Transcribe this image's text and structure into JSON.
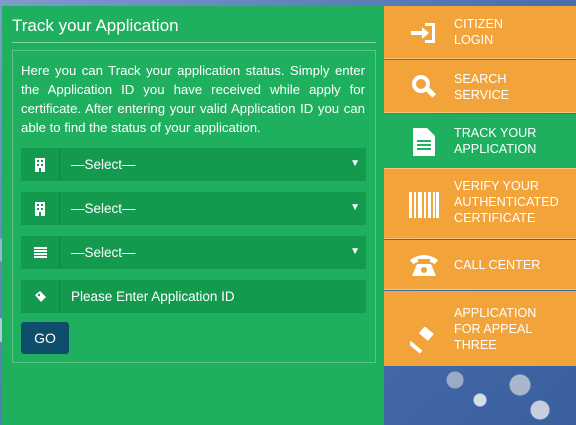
{
  "panel": {
    "title": "Track your Application",
    "description": "Here you can Track your application status. Simply enter the Application ID you have received while apply for certificate. After entering your valid Application ID you can able to find the status of your application.",
    "selects": [
      {
        "icon": "building-icon",
        "value": "—Select—"
      },
      {
        "icon": "office-icon",
        "value": "—Select—"
      },
      {
        "icon": "list-icon",
        "value": "—Select—"
      }
    ],
    "app_id_placeholder": "Please Enter Application ID",
    "go_label": "GO"
  },
  "menu": [
    {
      "icon": "login-icon",
      "label_1": "CITIZEN",
      "label_2": "LOGIN"
    },
    {
      "icon": "search-icon",
      "label_1": "SEARCH",
      "label_2": "SERVICE"
    },
    {
      "icon": "document-icon",
      "label_1": "TRACK YOUR",
      "label_2": "APPLICATION"
    },
    {
      "icon": "barcode-icon",
      "label_1": "VERIFY YOUR",
      "label_2": "AUTHENTICATED",
      "label_3": "CERTIFICATE"
    },
    {
      "icon": "phone-icon",
      "label_1": "CALL CENTER"
    },
    {
      "icon": "gavel-icon",
      "label_1": "APPLICATION",
      "label_2": "FOR APPEAL",
      "label_3": "THREE"
    }
  ],
  "colors": {
    "panel_green": "#1fb05f",
    "menu_orange": "#f2a33a",
    "go_blue": "#0f4e6b"
  }
}
